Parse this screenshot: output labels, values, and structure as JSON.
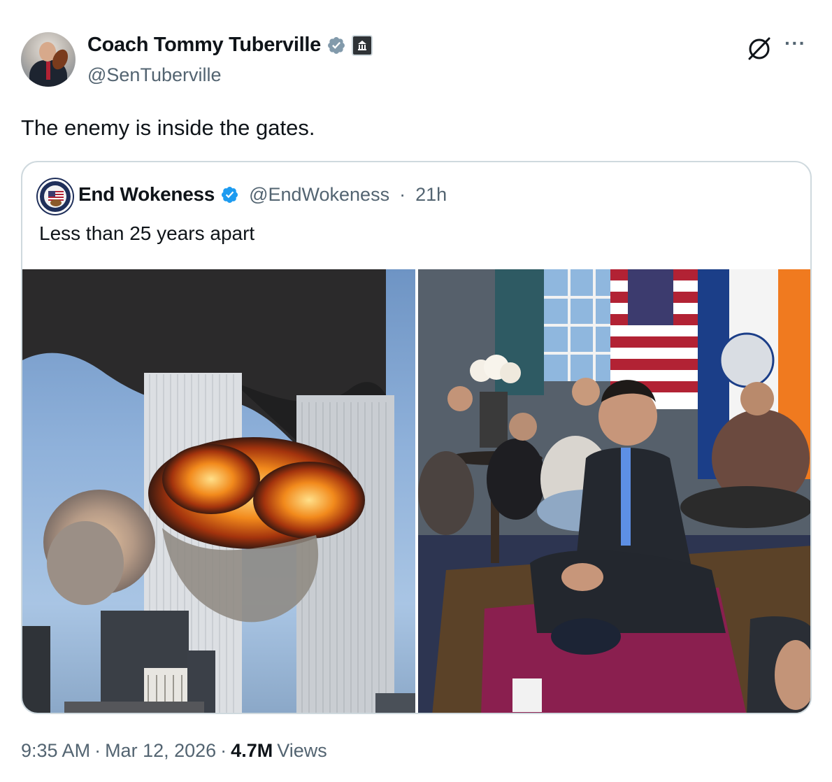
{
  "author": {
    "display_name": "Coach Tommy Tuberville",
    "handle": "@SenTuberville"
  },
  "icons": {
    "verified": "verified-badge-icon",
    "government": "government-badge-icon",
    "grok": "grok-icon",
    "more": "more-options-icon"
  },
  "colors": {
    "verified_badge": "#829aab",
    "quote_verified_badge": "#1d9bf0",
    "secondary_text": "#536471",
    "border": "#cfd9de"
  },
  "tweet": {
    "text": "The enemy is inside the gates.",
    "time": "9:35 AM",
    "date": "Mar 12, 2026",
    "views_count": "4.7M",
    "views_label": "Views",
    "separator": "·"
  },
  "quoted_tweet": {
    "display_name": "End Wokeness",
    "handle": "@EndWokeness",
    "separator": "·",
    "age": "21h",
    "text": "Less than 25 years apart"
  },
  "more_label": "···"
}
